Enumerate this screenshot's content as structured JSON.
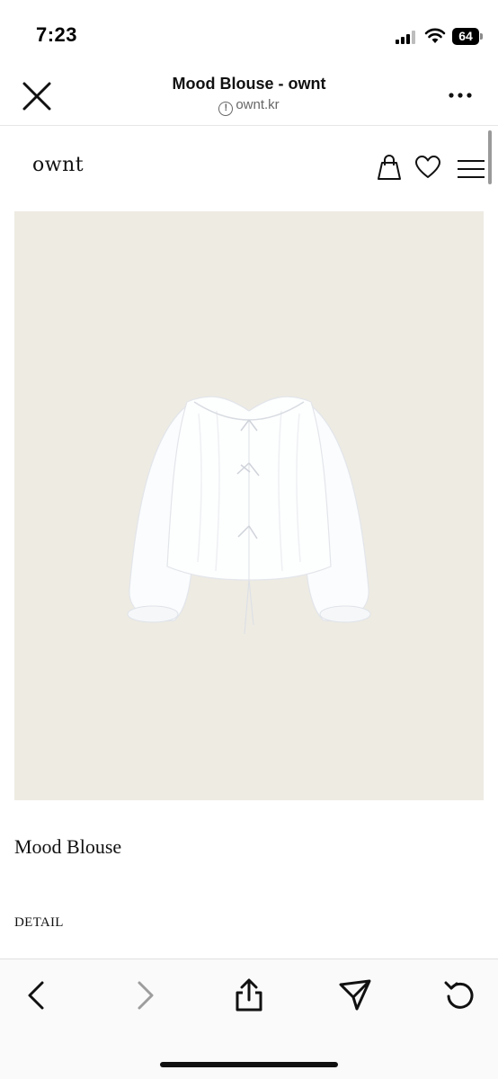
{
  "status_bar": {
    "time": "7:23",
    "battery_level": "64",
    "icons": [
      "cellular-signal-icon",
      "wifi-icon",
      "battery-icon"
    ]
  },
  "browser": {
    "title": "Mood Blouse - ownt",
    "url": "ownt.kr",
    "icons": [
      "close-icon",
      "info-icon",
      "more-icon"
    ]
  },
  "site": {
    "logo": "ownt",
    "icons": [
      "shopping-bag-icon",
      "heart-icon",
      "hamburger-menu-icon"
    ]
  },
  "product": {
    "name": "Mood Blouse",
    "detail_label": "DETAIL",
    "image_background": "#eeebe3"
  },
  "toolbar": {
    "icons": [
      "back-icon",
      "forward-icon",
      "share-icon",
      "send-icon",
      "reload-icon"
    ],
    "forward_enabled": false
  }
}
